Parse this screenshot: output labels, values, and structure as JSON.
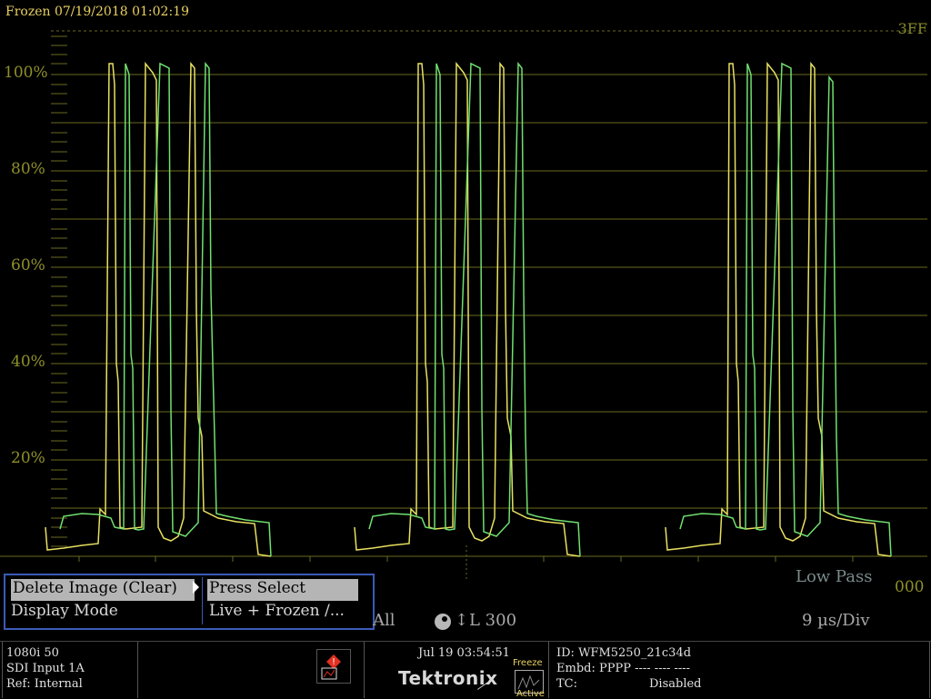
{
  "header": {
    "frozen_label": "Frozen 07/19/2018 01:02:19",
    "top_right": "3FF"
  },
  "graticule": {
    "labels": [
      "100%",
      "80%",
      "60%",
      "40%",
      "20%"
    ],
    "bottom_right": "000",
    "filter": "Low Pass"
  },
  "colors": {
    "trace_live": "#e8e060",
    "trace_frozen": "#70e070",
    "graticule": "#8a8a2a",
    "menu_border": "#3b5bb8"
  },
  "menu": {
    "rows": [
      {
        "label": "Delete Image (Clear)",
        "value": "Press Select"
      },
      {
        "label": "Display Mode",
        "value": "Live + Frozen /..."
      }
    ]
  },
  "readouts": {
    "channels": "All",
    "line": "L 300",
    "sweep": "9 µs/Div"
  },
  "status": {
    "format": "1080i 50",
    "input": "SDI Input 1A",
    "ref": "Ref: Internal",
    "datetime": "Jul 19 03:54:51",
    "brand": "Tektronix",
    "freeze_label": "Freeze",
    "active_label": "Active",
    "id": "ID: WFM5250_21c34d",
    "embd": "Embd: PPPP ---- ---- ----",
    "tc_label": "TC:",
    "tc_value": "Disabled"
  },
  "icons": {
    "alarm": "alarm-warning-icon",
    "freeze": "freeze-active-icon",
    "line_select": "line-select-icon"
  }
}
